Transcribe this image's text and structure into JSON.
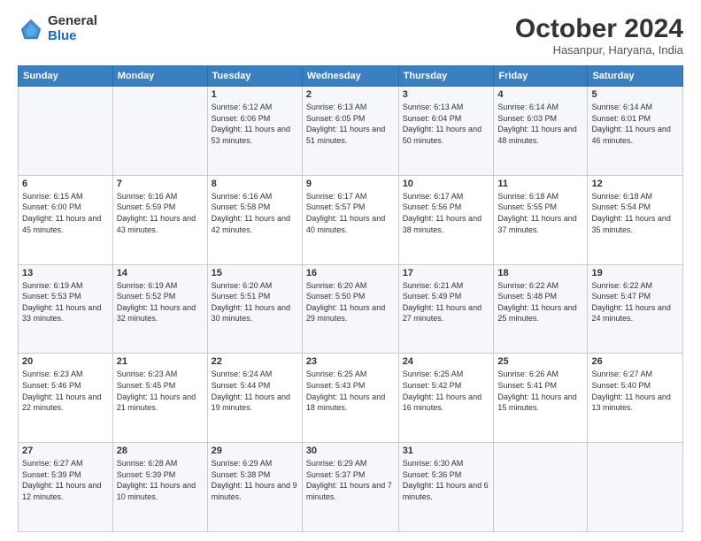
{
  "logo": {
    "general": "General",
    "blue": "Blue"
  },
  "header": {
    "title": "October 2024",
    "location": "Hasanpur, Haryana, India"
  },
  "weekdays": [
    "Sunday",
    "Monday",
    "Tuesday",
    "Wednesday",
    "Thursday",
    "Friday",
    "Saturday"
  ],
  "weeks": [
    [
      {
        "day": "",
        "info": ""
      },
      {
        "day": "",
        "info": ""
      },
      {
        "day": "1",
        "info": "Sunrise: 6:12 AM\nSunset: 6:06 PM\nDaylight: 11 hours and 53 minutes."
      },
      {
        "day": "2",
        "info": "Sunrise: 6:13 AM\nSunset: 6:05 PM\nDaylight: 11 hours and 51 minutes."
      },
      {
        "day": "3",
        "info": "Sunrise: 6:13 AM\nSunset: 6:04 PM\nDaylight: 11 hours and 50 minutes."
      },
      {
        "day": "4",
        "info": "Sunrise: 6:14 AM\nSunset: 6:03 PM\nDaylight: 11 hours and 48 minutes."
      },
      {
        "day": "5",
        "info": "Sunrise: 6:14 AM\nSunset: 6:01 PM\nDaylight: 11 hours and 46 minutes."
      }
    ],
    [
      {
        "day": "6",
        "info": "Sunrise: 6:15 AM\nSunset: 6:00 PM\nDaylight: 11 hours and 45 minutes."
      },
      {
        "day": "7",
        "info": "Sunrise: 6:16 AM\nSunset: 5:59 PM\nDaylight: 11 hours and 43 minutes."
      },
      {
        "day": "8",
        "info": "Sunrise: 6:16 AM\nSunset: 5:58 PM\nDaylight: 11 hours and 42 minutes."
      },
      {
        "day": "9",
        "info": "Sunrise: 6:17 AM\nSunset: 5:57 PM\nDaylight: 11 hours and 40 minutes."
      },
      {
        "day": "10",
        "info": "Sunrise: 6:17 AM\nSunset: 5:56 PM\nDaylight: 11 hours and 38 minutes."
      },
      {
        "day": "11",
        "info": "Sunrise: 6:18 AM\nSunset: 5:55 PM\nDaylight: 11 hours and 37 minutes."
      },
      {
        "day": "12",
        "info": "Sunrise: 6:18 AM\nSunset: 5:54 PM\nDaylight: 11 hours and 35 minutes."
      }
    ],
    [
      {
        "day": "13",
        "info": "Sunrise: 6:19 AM\nSunset: 5:53 PM\nDaylight: 11 hours and 33 minutes."
      },
      {
        "day": "14",
        "info": "Sunrise: 6:19 AM\nSunset: 5:52 PM\nDaylight: 11 hours and 32 minutes."
      },
      {
        "day": "15",
        "info": "Sunrise: 6:20 AM\nSunset: 5:51 PM\nDaylight: 11 hours and 30 minutes."
      },
      {
        "day": "16",
        "info": "Sunrise: 6:20 AM\nSunset: 5:50 PM\nDaylight: 11 hours and 29 minutes."
      },
      {
        "day": "17",
        "info": "Sunrise: 6:21 AM\nSunset: 5:49 PM\nDaylight: 11 hours and 27 minutes."
      },
      {
        "day": "18",
        "info": "Sunrise: 6:22 AM\nSunset: 5:48 PM\nDaylight: 11 hours and 25 minutes."
      },
      {
        "day": "19",
        "info": "Sunrise: 6:22 AM\nSunset: 5:47 PM\nDaylight: 11 hours and 24 minutes."
      }
    ],
    [
      {
        "day": "20",
        "info": "Sunrise: 6:23 AM\nSunset: 5:46 PM\nDaylight: 11 hours and 22 minutes."
      },
      {
        "day": "21",
        "info": "Sunrise: 6:23 AM\nSunset: 5:45 PM\nDaylight: 11 hours and 21 minutes."
      },
      {
        "day": "22",
        "info": "Sunrise: 6:24 AM\nSunset: 5:44 PM\nDaylight: 11 hours and 19 minutes."
      },
      {
        "day": "23",
        "info": "Sunrise: 6:25 AM\nSunset: 5:43 PM\nDaylight: 11 hours and 18 minutes."
      },
      {
        "day": "24",
        "info": "Sunrise: 6:25 AM\nSunset: 5:42 PM\nDaylight: 11 hours and 16 minutes."
      },
      {
        "day": "25",
        "info": "Sunrise: 6:26 AM\nSunset: 5:41 PM\nDaylight: 11 hours and 15 minutes."
      },
      {
        "day": "26",
        "info": "Sunrise: 6:27 AM\nSunset: 5:40 PM\nDaylight: 11 hours and 13 minutes."
      }
    ],
    [
      {
        "day": "27",
        "info": "Sunrise: 6:27 AM\nSunset: 5:39 PM\nDaylight: 11 hours and 12 minutes."
      },
      {
        "day": "28",
        "info": "Sunrise: 6:28 AM\nSunset: 5:39 PM\nDaylight: 11 hours and 10 minutes."
      },
      {
        "day": "29",
        "info": "Sunrise: 6:29 AM\nSunset: 5:38 PM\nDaylight: 11 hours and 9 minutes."
      },
      {
        "day": "30",
        "info": "Sunrise: 6:29 AM\nSunset: 5:37 PM\nDaylight: 11 hours and 7 minutes."
      },
      {
        "day": "31",
        "info": "Sunrise: 6:30 AM\nSunset: 5:36 PM\nDaylight: 11 hours and 6 minutes."
      },
      {
        "day": "",
        "info": ""
      },
      {
        "day": "",
        "info": ""
      }
    ]
  ]
}
